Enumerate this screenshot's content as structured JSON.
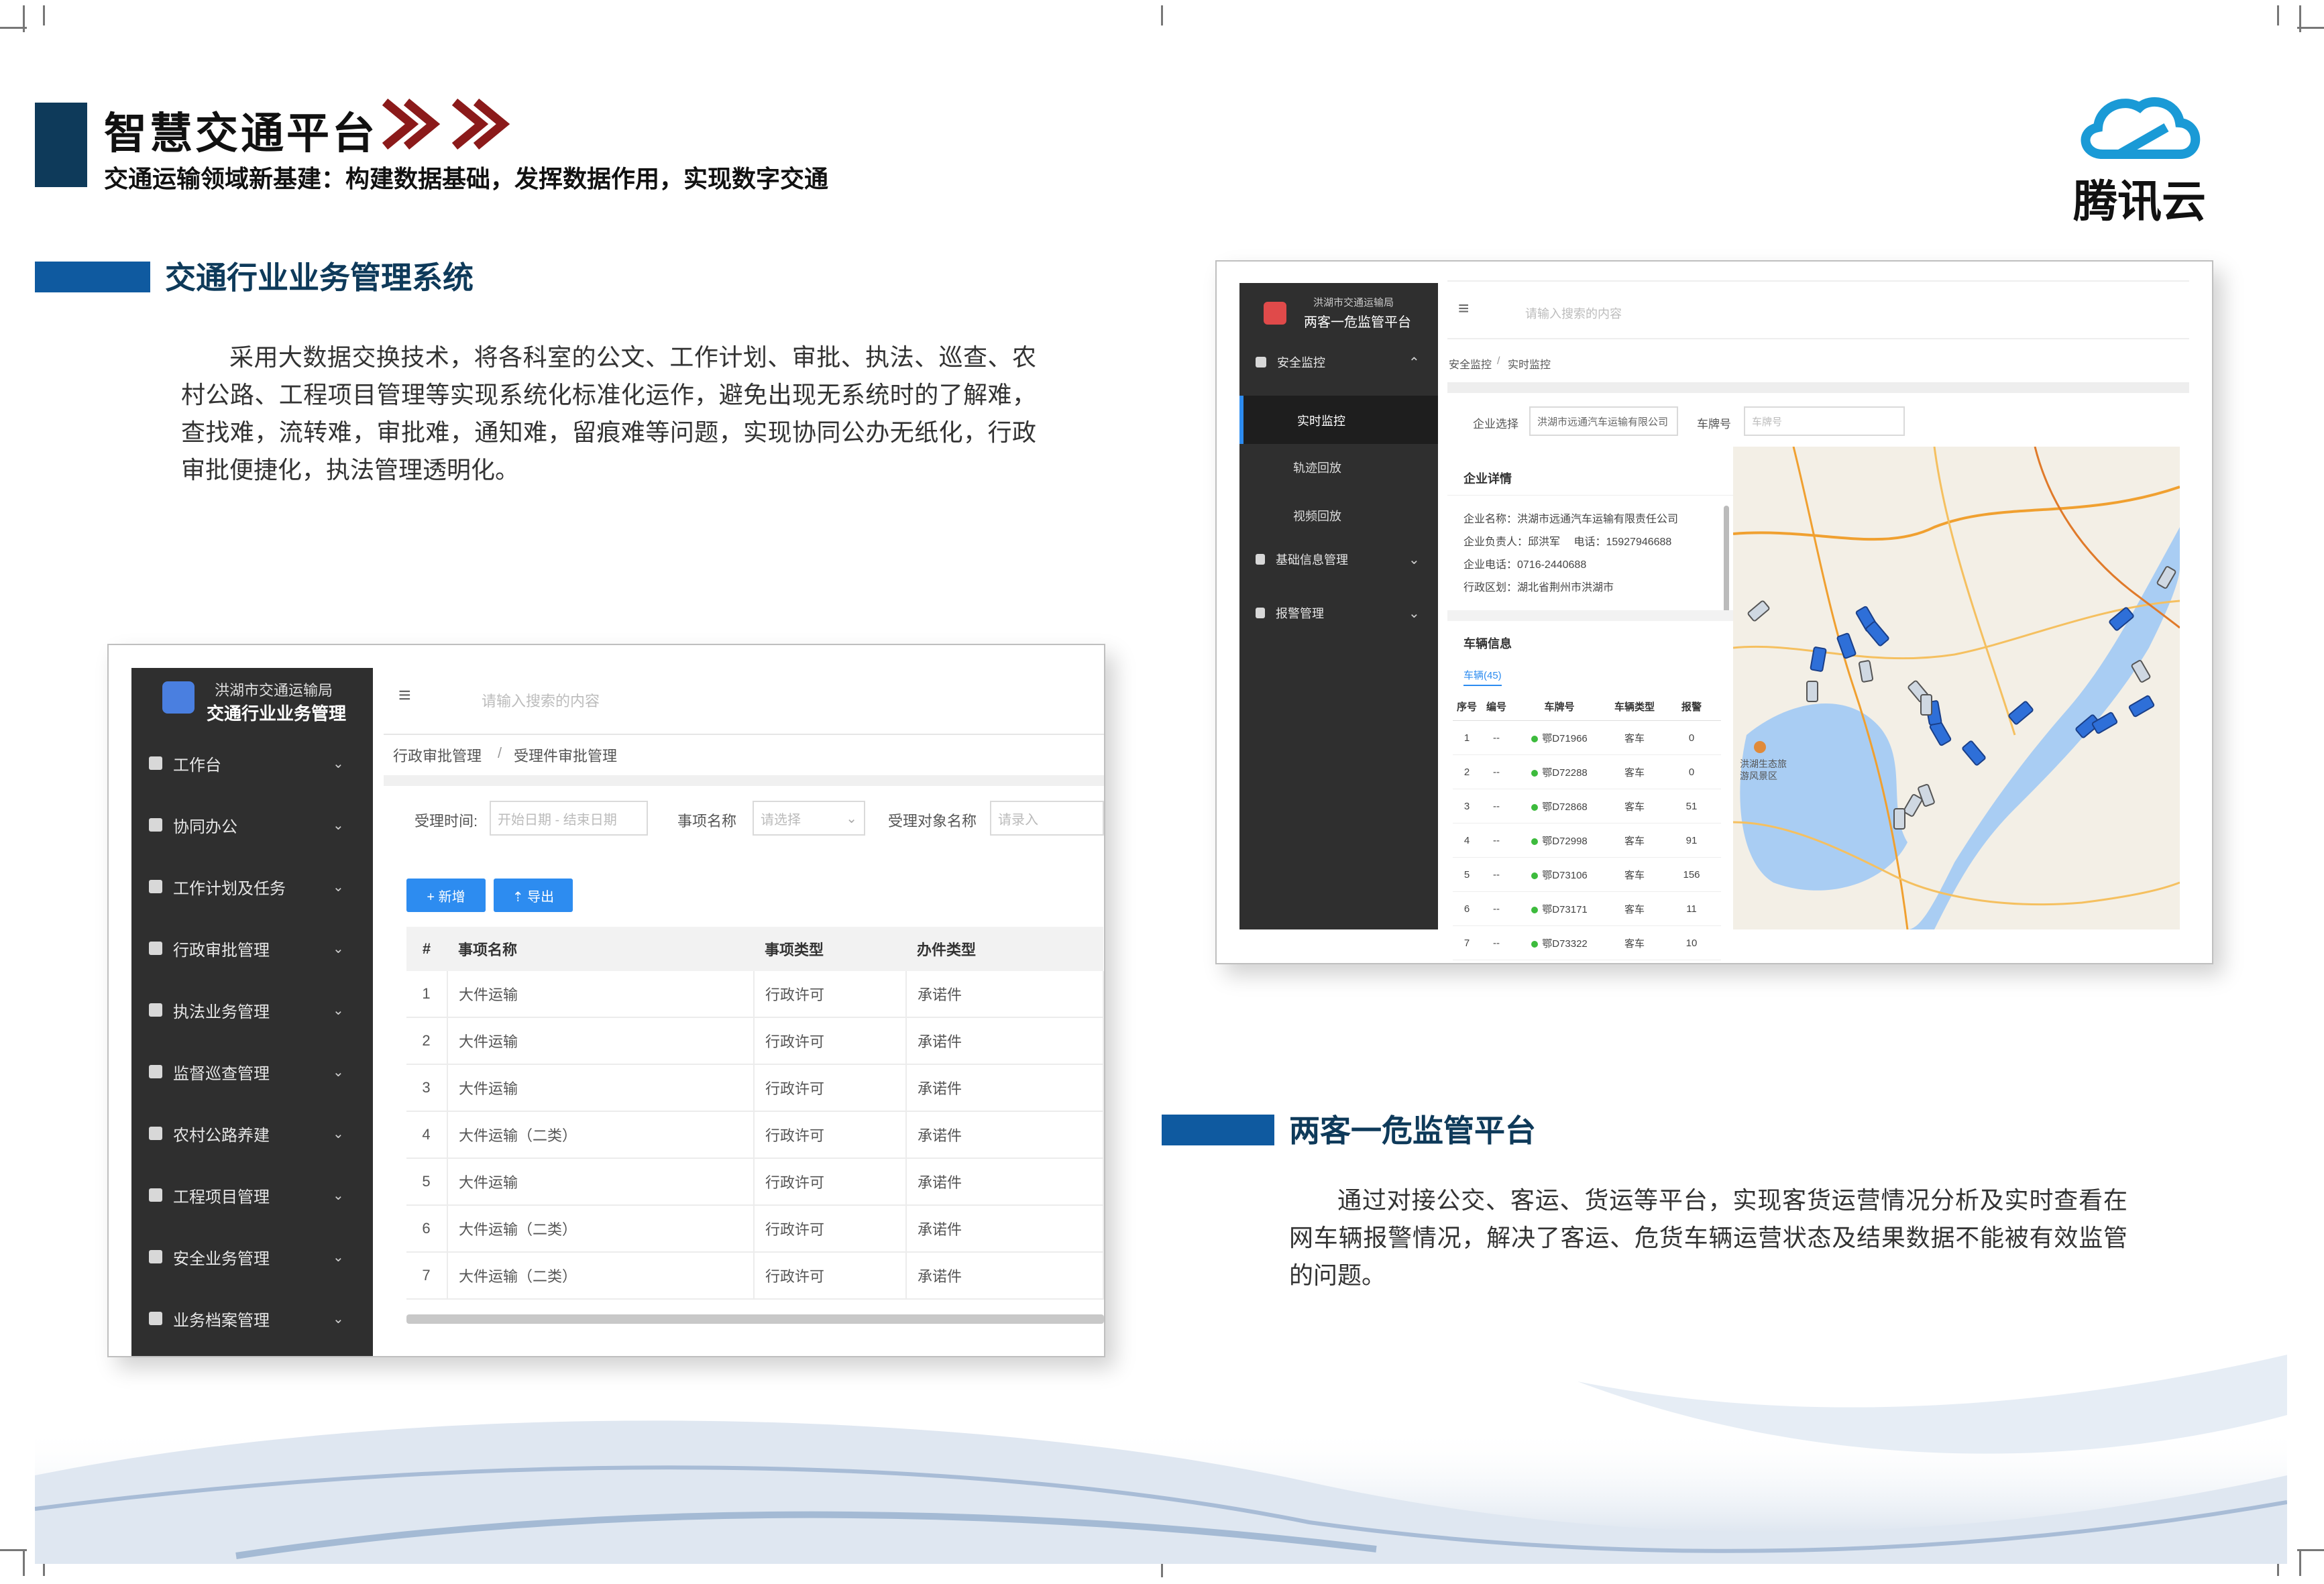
{
  "header": {
    "title": "智慧交通平台",
    "subtitle": "交通运输领域新基建：构建数据基础，发挥数据作用，实现数字交通",
    "brand": "腾讯云",
    "accent_color": "#0e3a5a",
    "chevron_color": "#8b1a1a",
    "section_color": "#0f5aa0"
  },
  "section1": {
    "title": "交通行业业务管理系统",
    "body": "采用大数据交换技术，将各科室的公文、工作计划、审批、执法、巡查、农村公路、工程项目管理等实现系统化标准化运作，避免出现无系统时的了解难，查找难，流转难，审批难，通知难，留痕难等问题，实现协同公办无纸化，行政审批便捷化，执法管理透明化。"
  },
  "section2": {
    "title": "两客一危监管平台",
    "body": "通过对接公交、客运、货运等平台，实现客货运营情况分析及实时查看在网车辆报警情况，解决了客运、危货车辆运营状态及结果数据不能被有效监管的问题。"
  },
  "app1": {
    "org": "洪湖市交通运输局",
    "name": "交通行业业务管理",
    "search_placeholder": "请输入搜索的内容",
    "menu": [
      "工作台",
      "协同办公",
      "工作计划及任务",
      "行政审批管理",
      "执法业务管理",
      "监督巡查管理",
      "农村公路养建",
      "工程项目管理",
      "安全业务管理",
      "业务档案管理"
    ],
    "breadcrumb": [
      "行政审批管理",
      "受理件审批管理"
    ],
    "filters": {
      "time_label": "受理时间:",
      "time_placeholder": "开始日期 - 结束日期",
      "item_label": "事项名称",
      "item_placeholder": "请选择",
      "target_label": "受理对象名称",
      "target_placeholder": "请录入"
    },
    "buttons": {
      "add": "+ 新增",
      "export": "⇡ 导出"
    },
    "columns": [
      "#",
      "事项名称",
      "事项类型",
      "办件类型"
    ],
    "rows": [
      [
        "1",
        "大件运输",
        "行政许可",
        "承诺件"
      ],
      [
        "2",
        "大件运输",
        "行政许可",
        "承诺件"
      ],
      [
        "3",
        "大件运输",
        "行政许可",
        "承诺件"
      ],
      [
        "4",
        "大件运输（二类）",
        "行政许可",
        "承诺件"
      ],
      [
        "5",
        "大件运输",
        "行政许可",
        "承诺件"
      ],
      [
        "6",
        "大件运输（二类）",
        "行政许可",
        "承诺件"
      ],
      [
        "7",
        "大件运输（二类）",
        "行政许可",
        "承诺件"
      ]
    ]
  },
  "app2": {
    "org": "洪湖市交通运输局",
    "name": "两客一危监管平台",
    "search_placeholder": "请输入搜索的内容",
    "menu_group": "安全监控",
    "menu_sub": [
      "实时监控",
      "轨迹回放",
      "视频回放"
    ],
    "menu_more": [
      "基础信息管理",
      "报警管理"
    ],
    "breadcrumb": [
      "安全监控",
      "实时监控"
    ],
    "company_label": "企业选择",
    "company_value": "洪湖市远通汽车运输有限公司",
    "plate_label": "车牌号",
    "plate_placeholder": "车牌号",
    "company_panel_title": "企业详情",
    "company_info": [
      "企业名称：洪湖市远通汽车运输有限责任公司",
      "企业负责人：邱洪军　 电话：15927946688",
      "企业电话：0716-2440688",
      "行政区划：湖北省荆州市洪湖市"
    ],
    "vehicle_panel_title": "车辆信息",
    "vehicle_tab": "车辆(45)",
    "vehicle_columns": [
      "序号",
      "编号",
      "车牌号",
      "车辆类型",
      "报警"
    ],
    "vehicles": [
      [
        "1",
        "--",
        "鄂D71966",
        "客车",
        "0"
      ],
      [
        "2",
        "--",
        "鄂D72288",
        "客车",
        "0"
      ],
      [
        "3",
        "--",
        "鄂D72868",
        "客车",
        "51"
      ],
      [
        "4",
        "--",
        "鄂D72998",
        "客车",
        "91"
      ],
      [
        "5",
        "--",
        "鄂D73106",
        "客车",
        "156"
      ],
      [
        "6",
        "--",
        "鄂D73171",
        "客车",
        "11"
      ],
      [
        "7",
        "--",
        "鄂D73322",
        "客车",
        "10"
      ]
    ],
    "map_label": "洪湖生态旅游风景区"
  }
}
